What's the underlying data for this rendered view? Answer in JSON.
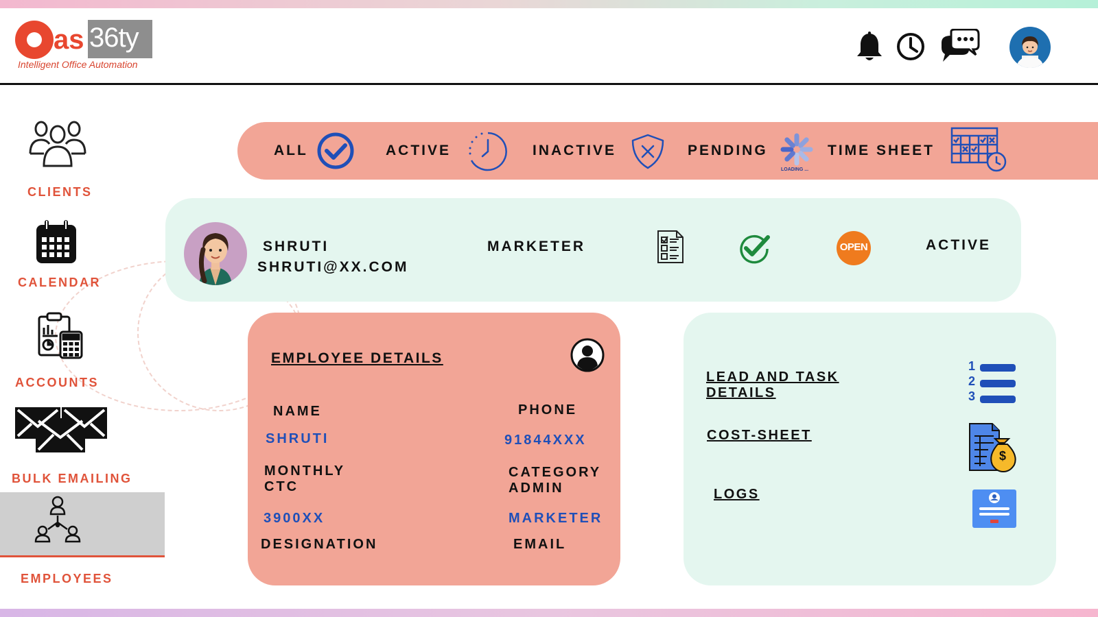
{
  "brand": {
    "logo_as": "as",
    "logo_box": "36ty",
    "tagline": "Intelligent Office Automation"
  },
  "header": {
    "icons": [
      "bell-icon",
      "clock-icon",
      "chat-icon",
      "user-avatar"
    ]
  },
  "sidebar": {
    "items": [
      {
        "label": "CLIENTS",
        "icon": "clients-icon"
      },
      {
        "label": "CALENDAR",
        "icon": "calendar-icon"
      },
      {
        "label": "ACCOUNTS",
        "icon": "accounts-icon"
      },
      {
        "label": "BULK EMAILING",
        "icon": "mail-icon"
      },
      {
        "label": "EMPLOYEES",
        "icon": "employees-icon",
        "active": true
      }
    ]
  },
  "filters": {
    "all": "ALL",
    "active": "ACTIVE",
    "inactive": "INACTIVE",
    "pending": "PENDING",
    "loading": "LOADING ...",
    "timesheet": "TIME SHEET"
  },
  "employee_row": {
    "name": "SHRUTI",
    "email": "SHRUTI@XX.COM",
    "role": "MARKETER",
    "badge": "OPEN",
    "status": "ACTIVE"
  },
  "employee_details": {
    "title": "EMPLOYEE DETAILS",
    "name_label": "NAME",
    "name_value": "SHRUTI",
    "phone_label": "PHONE",
    "phone_value": "91844XXX",
    "ctc_label_1": "MONTHLY",
    "ctc_label_2": "CTC",
    "ctc_value": "3900XX",
    "category_label_1": "CATEGORY",
    "category_label_2": "ADMIN",
    "category_value": "MARKETER",
    "designation_label": "DESIGNATION",
    "email_label": "EMAIL"
  },
  "links": {
    "lead_1": "LEAD AND TASK",
    "lead_2": "DETAILS",
    "cost": "COST-SHEET",
    "logs": "LOGS",
    "list_numbers": [
      "1",
      "2",
      "3"
    ],
    "cost_currency": "$"
  },
  "colors": {
    "accent": "#e8472f",
    "salmon": "#f2a596",
    "mint": "#e4f6ef",
    "blue": "#1f4fb8"
  }
}
